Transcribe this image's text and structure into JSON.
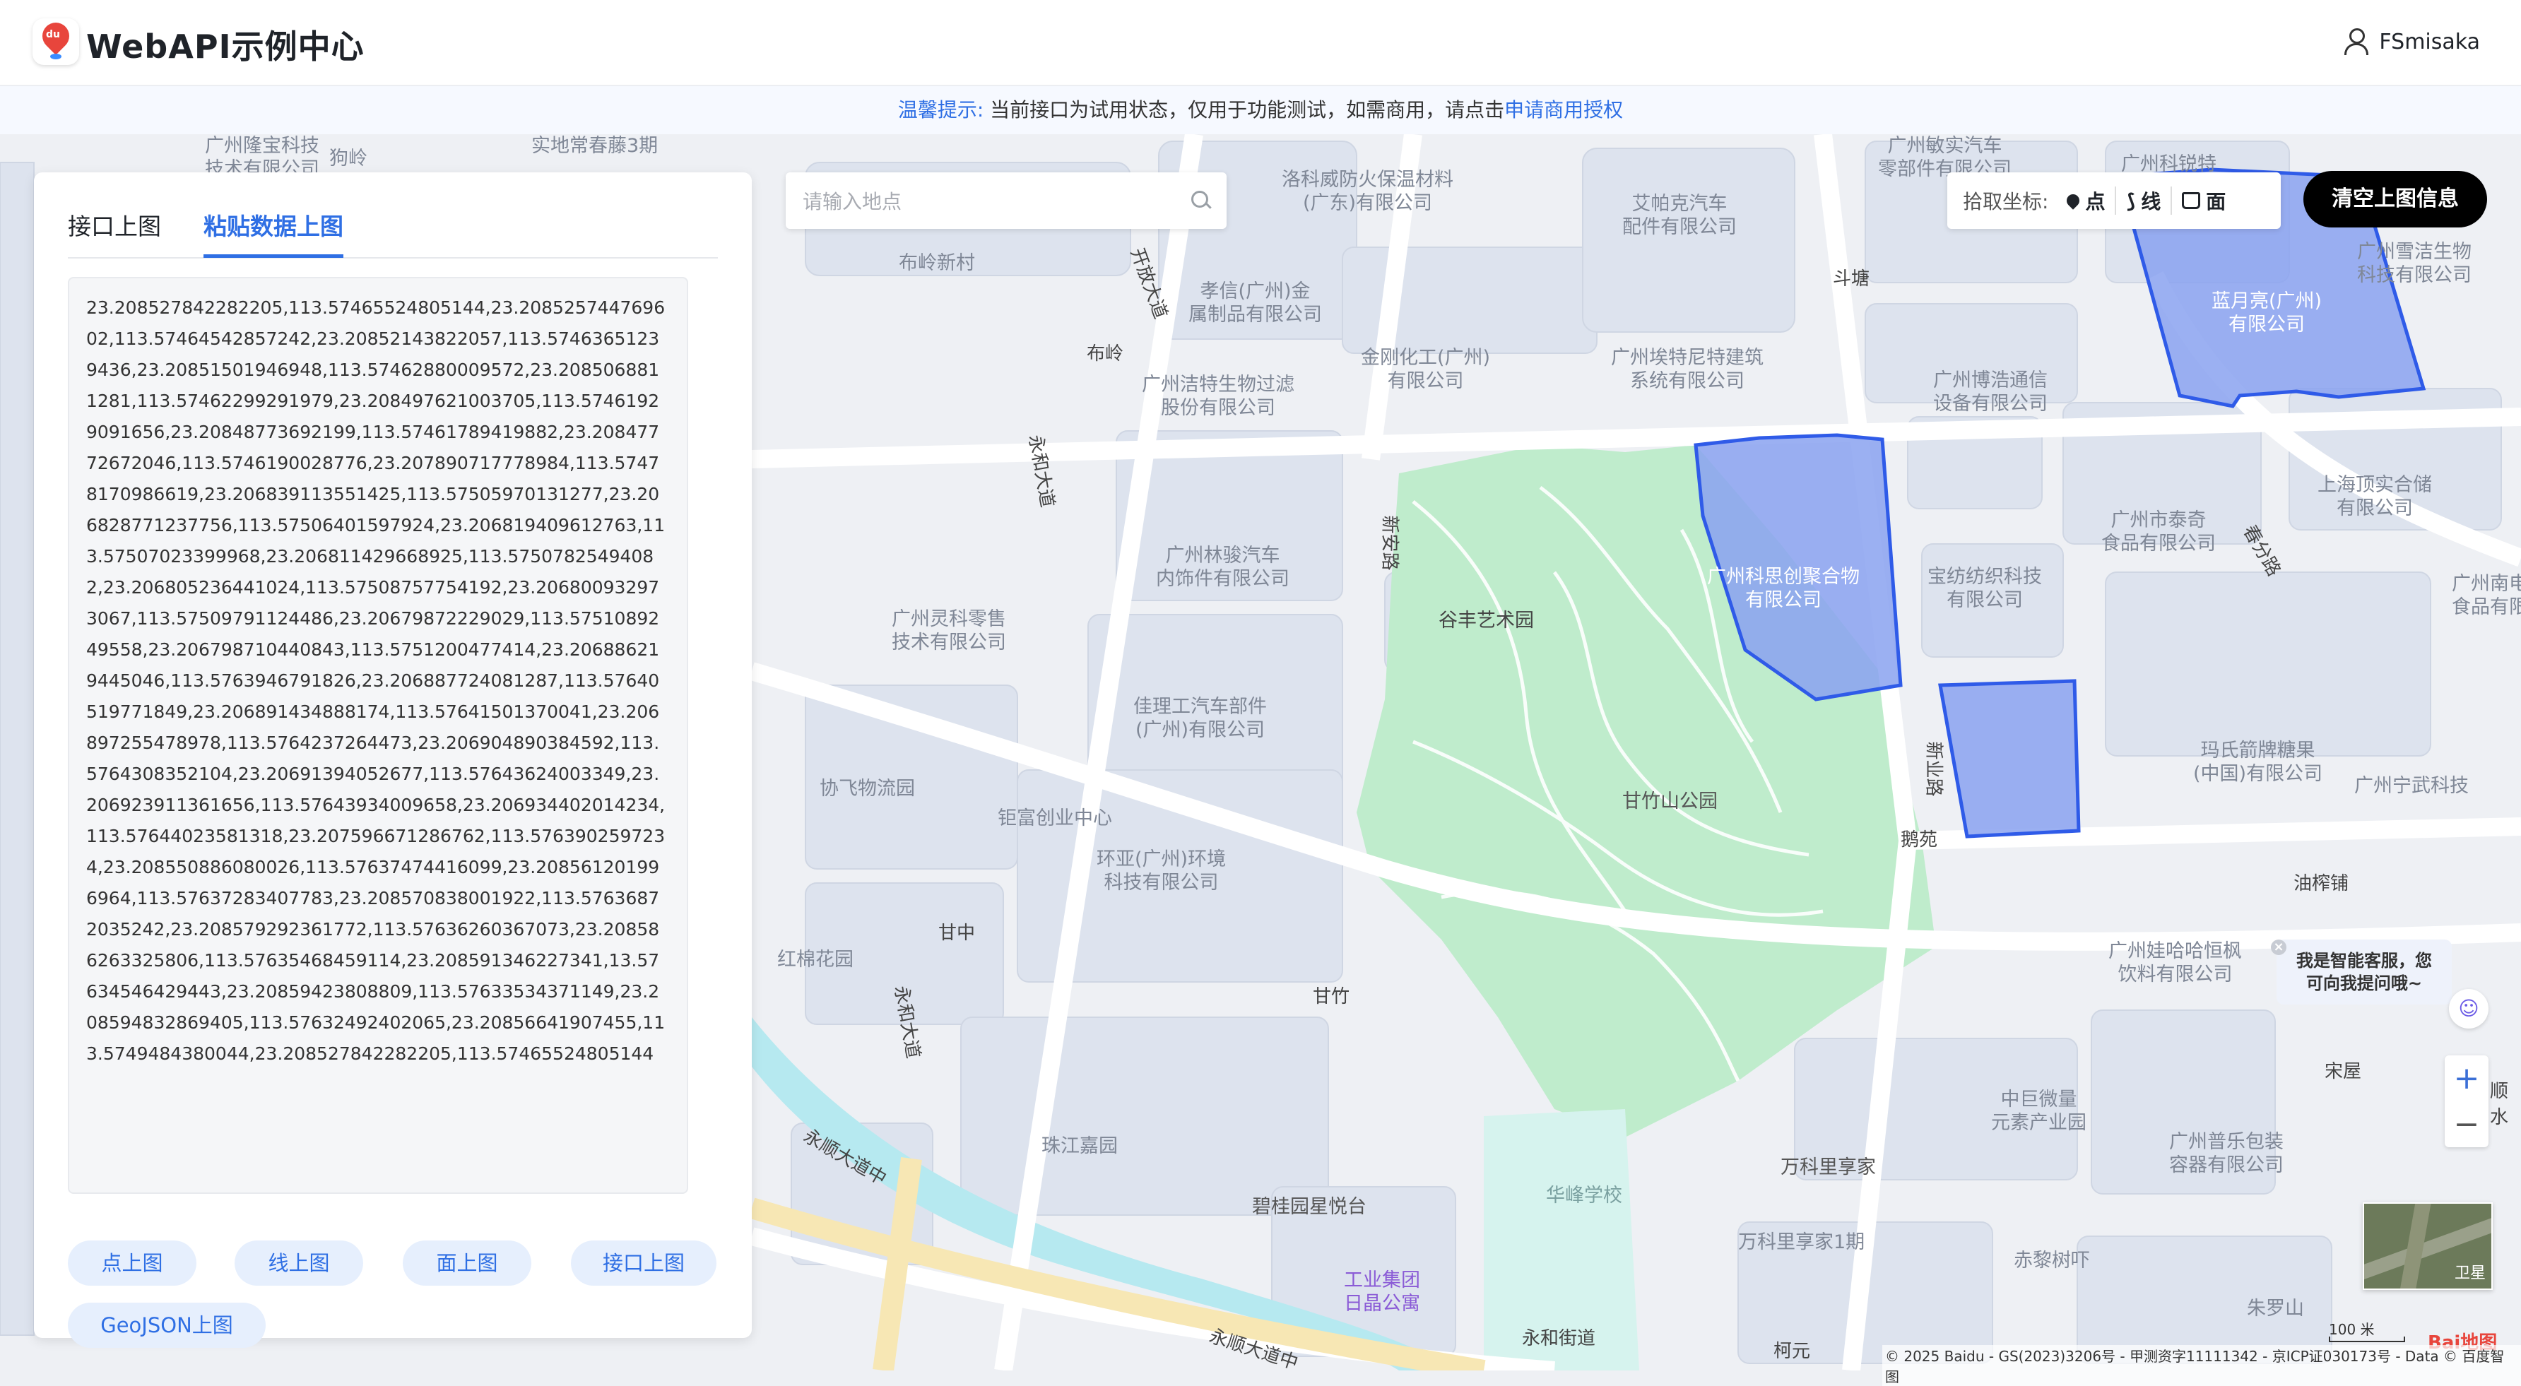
{
  "header": {
    "brand": "WebAPI示例中心",
    "logo_text": "du",
    "username": "FSmisaka"
  },
  "notice": {
    "label": "温馨提示:",
    "text": "当前接口为试用状态，仅用于功能测试，如需商用，请点击",
    "link": "申请商用授权"
  },
  "panel": {
    "tabs": [
      {
        "label": "接口上图",
        "active": false
      },
      {
        "label": "粘贴数据上图",
        "active": true
      }
    ],
    "data_text": "23.208527842282205,113.57465524805144,23.208525744769602,113.57464542857242,23.20852143822057,113.57463651239436,23.20851501946948,113.57462880009572,23.2085068811281,113.57462299291979,23.208497621003705,113.57461929091656,23.20848773692199,113.57461789419882,23.20847772672046,113.5746190028776,23.207890717778984,113.57478170986619,23.206839113551425,113.57505970131277,23.206828771237756,113.57506401597924,23.206819409612763,113.57507023399968,23.206811429668925,113.57507825494082,23.206805236441024,113.57508757754192,23.206800932973067,113.57509791124486,23.20679872229029,113.5751089249558,23.206798710440843,113.5751200477414,23.206886219445046,113.5763946791826,23.206887724081287,113.57640519771849,23.206891434888174,113.57641501370041,23.206897255478978,113.5764237264473,23.206904890384592,113.5764308352104,23.20691394052677,113.57643624003349,23.206923911361656,113.57643934009658,23.206934402014234,113.57644023581318,23.207596671286762,113.5763902597234,23.208550886080026,113.57637474416099,23.208561201996964,113.57637283407783,23.208570838001922,113.57636872035242,23.208579292361772,113.57636260367073,23.208586263325806,113.57635468459114,23.208591346227341,13.57634546429443,23.20859423808809,113.57633534371149,23.208594832869405,113.57632492402065,23.20856641907455,113.5749484380044,23.208527842282205,113.57465524805144",
    "buttons": [
      "点上图",
      "线上图",
      "面上图",
      "接口上图",
      "GeoJSON上图"
    ]
  },
  "search": {
    "placeholder": "请输入地点",
    "value": ""
  },
  "pick": {
    "label": "拾取坐标:",
    "items": [
      "点",
      "线",
      "面"
    ]
  },
  "clear_button": "清空上图信息",
  "chat": {
    "text_line1": "我是智能客服，您",
    "text_line2": "可向我提问哦~",
    "close": "×"
  },
  "zoom": {
    "in": "+",
    "out": "−"
  },
  "satellite_label": "卫星",
  "scale": "100 米",
  "baidu_logo": "Bai地图",
  "copyright": "© 2025 Baidu - GS(2023)3206号 - 甲测资字11111342 - 京ICP证030173号 - Data © 百度智图",
  "map_labels": {
    "l1": "广州隆宝科技\n技术有限公司",
    "l2": "狗岭",
    "l3": "实地常春藤3期",
    "l4": "洛科威防火保温材料\n(广东)有限公司",
    "l5": "艾帕克汽车\n配件有限公司",
    "l6": "广州敏实汽车\n零部件有限公司",
    "l7": "广州科锐特",
    "l8": "布岭新村",
    "l9": "孝信(广州)金\n属制品有限公司",
    "l10": "金刚化工(广州)\n有限公司",
    "l11": "广州埃特尼特建筑\n系统有限公司",
    "l12": "斗塘",
    "l13": "蓝月亮(广州)\n有限公司",
    "l14": "广州雪洁生物\n科技有限公司",
    "l15": "广州洁特生物过滤\n股份有限公司",
    "l16": "广州博浩通信\n设备有限公司",
    "l17": "上海顶实合储\n有限公司",
    "l18": "广州林骏汽车\n内饰件有限公司",
    "l19": "广州科思创聚合物\n有限公司",
    "l20": "宝纺纺织科技\n有限公司",
    "l21": "广州市泰奇\n食品有限公司",
    "l22": "广州南电\n食品有限",
    "l23": "谷丰艺术园",
    "l24": "广州灵科零售\n技术有限公司",
    "l25": "佳理工汽车部件\n(广州)有限公司",
    "l26": "玛氏箭牌糖果\n(中国)有限公司",
    "l27": "广州宁武科技",
    "l28": "甘竹山公园",
    "l29": "协飞物流园",
    "l30": "钜富创业中心",
    "l31": "环亚(广州)环境\n科技有限公司",
    "l32": "油榨铺",
    "l33": "甘中",
    "l34": "红棉花园",
    "l35": "甘竹",
    "l36": "广州娃哈哈恒枫\n饮料有限公司",
    "l37": "宋屋",
    "l38": "中巨微量\n元素产业园",
    "l39": "广州普乐包装\n容器有限公司",
    "l40": "珠江嘉园",
    "l41": "万科里享家",
    "l42": "华峰学校",
    "l43": "碧桂园星悦台",
    "l44": "工业集团\n日晶公寓",
    "l45": "万科里享家1期",
    "l46": "赤黎树吓",
    "l47": "朱罗山",
    "l48": "永和街道",
    "l49": "柯元",
    "l50": "顺水"
  },
  "roads": {
    "r1": "开放大道",
    "r2": "布岭",
    "r3": "永和大道",
    "r4": "新安路",
    "r5": "新业路",
    "r6": "鹅苑",
    "r7": "永和大道",
    "r8": "永顺大道中",
    "r9": "永顺大道中",
    "r10": "春分路"
  },
  "colors": {
    "accent": "#2f6fe4",
    "park": "#bfeccc",
    "polygon_fill": "#8aa2f0",
    "polygon_stroke": "#2f5be8",
    "water": "#b6e9f0",
    "block": "#dde3ee"
  }
}
